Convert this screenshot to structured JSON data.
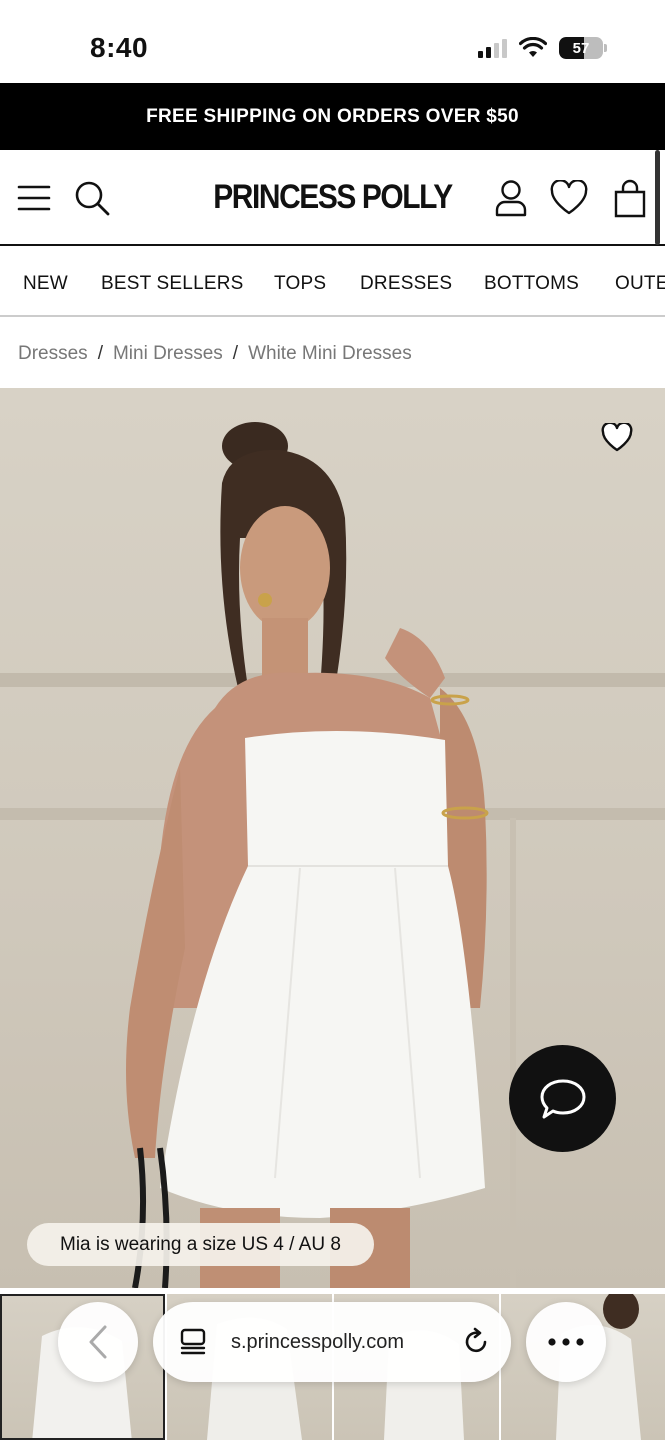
{
  "status_bar": {
    "time": "8:40",
    "battery": "57",
    "battery_level": 0.57
  },
  "promo": {
    "text": "FREE SHIPPING ON ORDERS OVER $50"
  },
  "header": {
    "logo": "PRINCESS POLLY"
  },
  "nav": {
    "items": [
      "NEW",
      "BEST SELLERS",
      "TOPS",
      "DRESSES",
      "BOTTOMS",
      "OUTE"
    ]
  },
  "breadcrumb": {
    "items": [
      "Dresses",
      "Mini Dresses",
      "White Mini Dresses"
    ],
    "separator": "/"
  },
  "product": {
    "caption": "Mia is wearing a size US 4 / AU 8"
  },
  "browser": {
    "url": "s.princesspolly.com"
  },
  "icons": {
    "menu": "hamburger-icon",
    "search": "search-icon",
    "account": "user-icon",
    "wishlist": "heart-icon",
    "bag": "bag-icon",
    "chat": "chat-bubble-icon",
    "back": "chevron-left-icon",
    "tabs": "tabs-icon",
    "reload": "reload-icon",
    "more": "more-dots-icon"
  },
  "colors": {
    "promo_bg": "#000000",
    "chat_bg": "#111111"
  }
}
